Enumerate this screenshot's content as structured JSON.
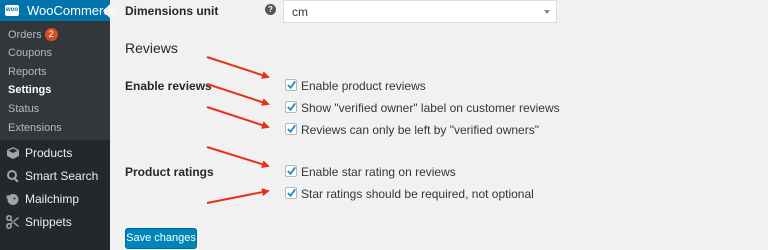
{
  "sidebar": {
    "woocommerce_label": "WooCommerce",
    "logo_text": "woo",
    "submenu": [
      {
        "label": "Orders",
        "badge": "2"
      },
      {
        "label": "Coupons"
      },
      {
        "label": "Reports"
      },
      {
        "label": "Settings",
        "active": true
      },
      {
        "label": "Status"
      },
      {
        "label": "Extensions"
      }
    ],
    "menu": [
      {
        "label": "Products",
        "icon": "products-icon"
      },
      {
        "label": "Smart Search",
        "icon": "search-icon"
      },
      {
        "label": "Mailchimp",
        "icon": "mailchimp-icon"
      },
      {
        "label": "Snippets",
        "icon": "snippets-icon"
      }
    ]
  },
  "settings": {
    "dimensions_label": "Dimensions unit",
    "help_icon_text": "?",
    "dimensions_value": "cm",
    "section_title": "Reviews",
    "enable_reviews_label": "Enable reviews",
    "product_ratings_label": "Product ratings",
    "options": [
      {
        "label": "Enable product reviews",
        "checked": true
      },
      {
        "label": "Show \"verified owner\" label on customer reviews",
        "checked": true
      },
      {
        "label": "Reviews can only be left by \"verified owners\"",
        "checked": true
      },
      {
        "label": "Enable star rating on reviews",
        "checked": true
      },
      {
        "label": "Star ratings should be required, not optional",
        "checked": true
      }
    ],
    "save_label": "Save changes"
  },
  "colors": {
    "sidebar_bg": "#23282d",
    "accent_blue": "#0073aa",
    "button_blue": "#0085ba",
    "annotation_arrow": "#e8311a"
  }
}
